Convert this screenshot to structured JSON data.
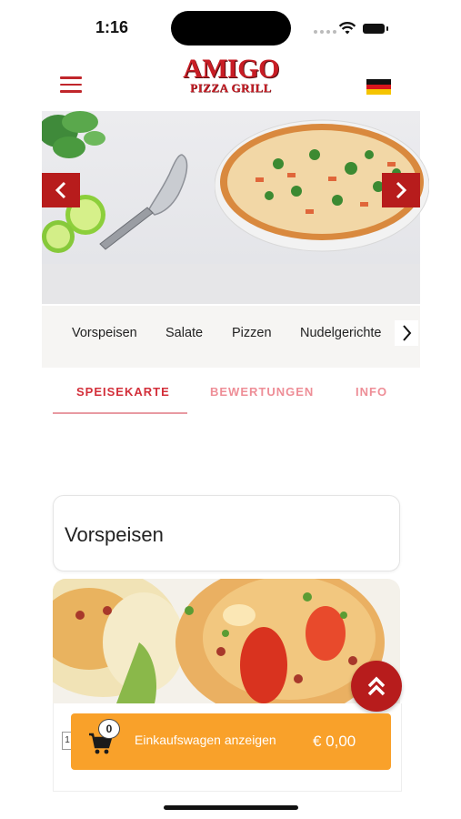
{
  "status_bar": {
    "time": "1:16"
  },
  "header": {
    "logo_top": "AMIGO",
    "logo_bottom": "PIZZA GRILL",
    "language_flag": "germany-flag"
  },
  "categories": [
    "Vorspeisen",
    "Salate",
    "Pizzen",
    "Nudelgerichte"
  ],
  "tabs": [
    {
      "label": "SPEISEKARTE",
      "active": true
    },
    {
      "label": "BEWERTUNGEN",
      "active": false
    },
    {
      "label": "INFO",
      "active": false
    }
  ],
  "section": {
    "title": "Vorspeisen"
  },
  "cart": {
    "count": "0",
    "label": "Einkaufswagen anzeigen",
    "total": "€ 0,00"
  },
  "qty_hint": "1",
  "colors": {
    "brand_red": "#b71c1c",
    "tab_active": "#d32f3a",
    "cart_orange": "#f9a12a"
  }
}
